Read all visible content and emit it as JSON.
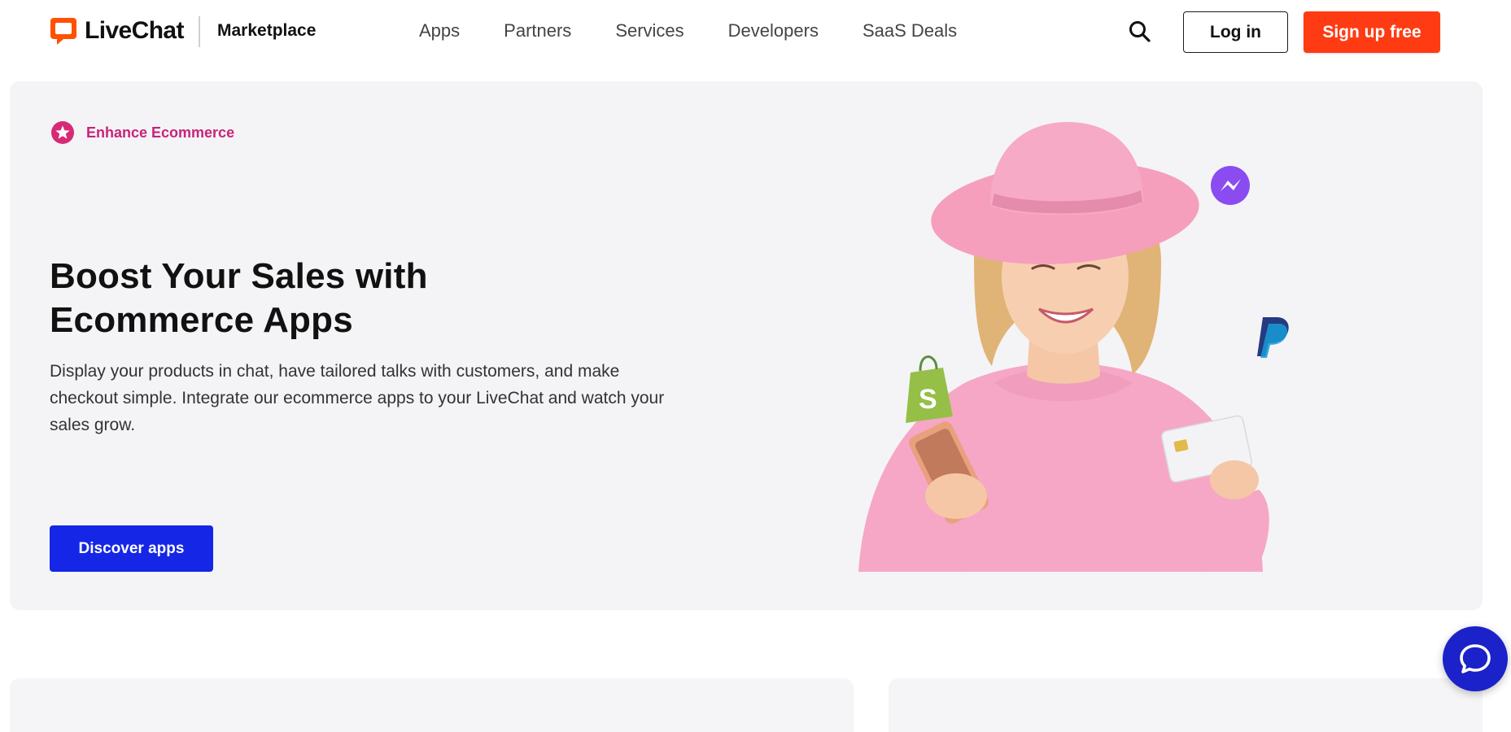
{
  "header": {
    "brand": "LiveChat",
    "brand_sub": "Marketplace",
    "nav": [
      {
        "label": "Apps"
      },
      {
        "label": "Partners"
      },
      {
        "label": "Services"
      },
      {
        "label": "Developers"
      },
      {
        "label": "SaaS Deals"
      }
    ],
    "search_icon": "search-icon",
    "login_label": "Log in",
    "signup_label": "Sign up free"
  },
  "hero": {
    "badge_icon": "star-icon",
    "badge_label": "Enhance Ecommerce",
    "title_line1": "Boost Your Sales with",
    "title_line2": "Ecommerce Apps",
    "description": "Display your products in chat, have tailored talks with customers, and make checkout simple. Integrate our ecommerce apps to your LiveChat and watch your sales grow.",
    "cta_label": "Discover apps",
    "illustration_icons": [
      "messenger-icon",
      "paypal-icon",
      "shopify-icon"
    ]
  },
  "chat_widget": {
    "icon": "chat-bubble-icon"
  },
  "colors": {
    "brand_orange": "#ff5100",
    "signup_red": "#ff3b13",
    "badge_pink": "#c8237a",
    "cta_blue": "#1526e6",
    "hero_bg": "#f4f4f6",
    "widget_blue": "#1b22c9"
  }
}
